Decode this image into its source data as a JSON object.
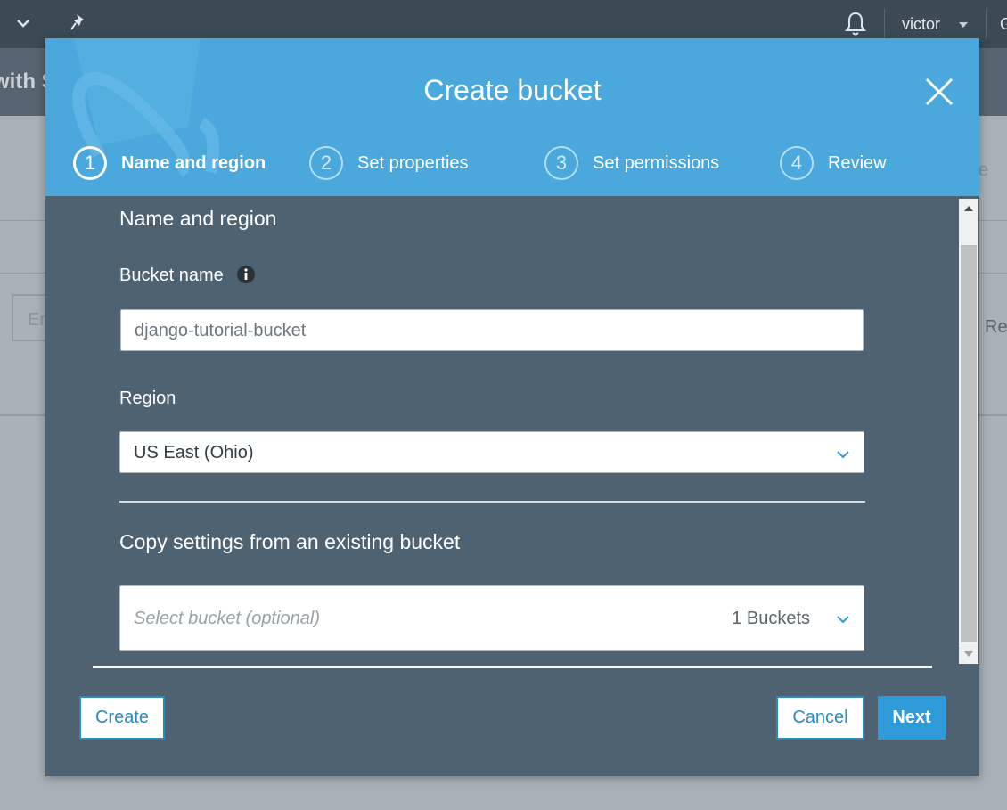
{
  "topbar": {
    "user": "victor",
    "clipped_text": "G"
  },
  "background": {
    "subheader_title": "with S",
    "input_placeholder": "En",
    "right_text": "Re",
    "right_text_2": "e"
  },
  "modal": {
    "title": "Create bucket",
    "steps": [
      {
        "number": "1",
        "label": "Name and region",
        "active": true
      },
      {
        "number": "2",
        "label": "Set properties",
        "active": false
      },
      {
        "number": "3",
        "label": "Set permissions",
        "active": false
      },
      {
        "number": "4",
        "label": "Review",
        "active": false
      }
    ],
    "section_title": "Name and region",
    "bucket_name_label": "Bucket name",
    "bucket_name_value": "django-tutorial-bucket",
    "region_label": "Region",
    "region_value": "US East (Ohio)",
    "copy_settings_title": "Copy settings from an existing bucket",
    "copy_select_placeholder": "Select bucket (optional)",
    "copy_select_count": "1 Buckets",
    "buttons": {
      "create": "Create",
      "cancel": "Cancel",
      "next": "Next"
    }
  },
  "colors": {
    "header_blue": "#4aa8dc",
    "modal_body": "#4e6271",
    "accent": "#2e9ad8"
  }
}
